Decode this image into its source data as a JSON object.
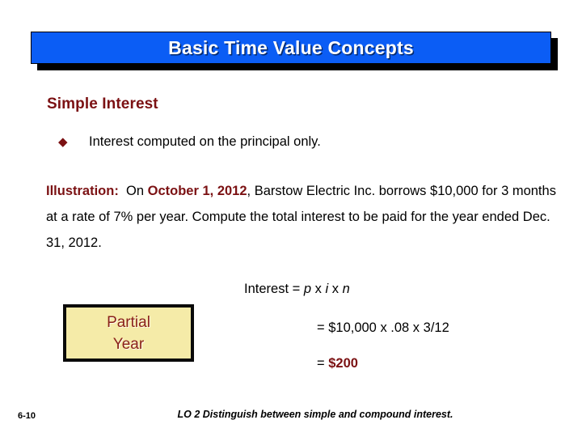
{
  "slide": {
    "title": "Basic Time Value Concepts",
    "section_heading": "Simple Interest",
    "bullet": {
      "marker": "diamond-bullet",
      "marker_glyph": "◆",
      "text": "Interest computed on the principal only."
    },
    "illustration": {
      "label": "Illustration:",
      "lead_in": "On",
      "date": "October 1, 2012",
      "body_part_1": ", Barstow Electric Inc. borrows $10,000 for 3 months at a rate of 7% per year.  Compute the total interest to be paid for the year ended Dec. 31, 2012."
    },
    "formula": {
      "label": "Interest =",
      "var_p": "p",
      "times_1": "x",
      "var_i": "i",
      "times_2": "x",
      "var_n": "n"
    },
    "callout_box": {
      "line_1": "Partial",
      "line_2": "Year",
      "background_color": "#F5EBA8",
      "text_color": "#8A2118",
      "border_color": "#0A0A0A"
    },
    "calculation": {
      "line_1": "= $10,000  x  .08 x  3/12",
      "line_2_prefix": "= ",
      "line_2_result": "$200"
    },
    "footer": {
      "slide_number": "6-10",
      "learning_objective": "LO 2  Distinguish between simple and compound interest."
    },
    "colors": {
      "banner_blue": "#0B5DF5",
      "accent_maroon": "#7B1113",
      "callout_red": "#8A2118",
      "callout_cream": "#F5EBA8"
    }
  }
}
